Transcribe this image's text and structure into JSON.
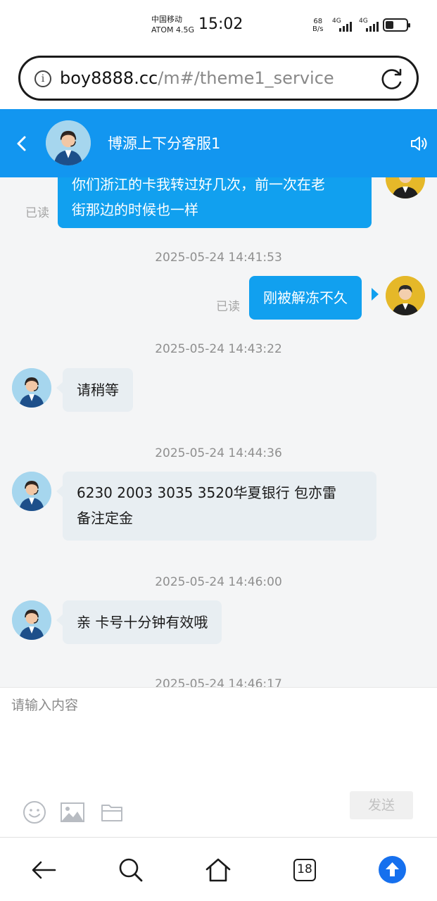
{
  "status_bar": {
    "carrier_name": "中国移动",
    "network_type": "ATOM 4.5G",
    "time": "15:02",
    "net_speed_value": "68",
    "net_speed_unit": "B/s",
    "signal1_label": "4G",
    "signal2_label": "4G",
    "battery_level": 0.4
  },
  "url_bar": {
    "host": "boy8888.cc",
    "path": "/m#/theme1_service"
  },
  "chat_header": {
    "title": "博源上下分客服1"
  },
  "messages": {
    "msg1_line1": "你们浙江的卡我转过好几次，前一次在老",
    "msg1_line2": "街那边的时候也一样",
    "msg1_status": "已读",
    "ts2": "2025-05-24 14:41:53",
    "msg2_text": "刚被解冻不久",
    "msg2_status": "已读",
    "ts3": "2025-05-24 14:43:22",
    "msg3_text": "请稍等",
    "ts4": "2025-05-24 14:44:36",
    "msg4_line1": "6230 2003 3035 3520华夏银行 包亦雷",
    "msg4_line2": "备注定金",
    "ts5": "2025-05-24 14:46:00",
    "msg5_text": "亲 卡号十分钟有效哦",
    "ts6": "2025-05-24 14:46:17"
  },
  "input": {
    "placeholder": "请输入内容",
    "send_label": "发送"
  },
  "nav_bar": {
    "tab_count": "18"
  },
  "colors": {
    "header_blue": "#1296f0",
    "outgoing_bubble": "#11a0ef",
    "incoming_bubble": "#e8eef2",
    "upload_button": "#1670ee"
  },
  "icons": [
    "info-icon",
    "reload-icon",
    "back-arrow-icon",
    "speaker-icon",
    "emoji-icon",
    "image-icon",
    "folder-icon",
    "search-icon",
    "home-icon",
    "upload-icon"
  ]
}
